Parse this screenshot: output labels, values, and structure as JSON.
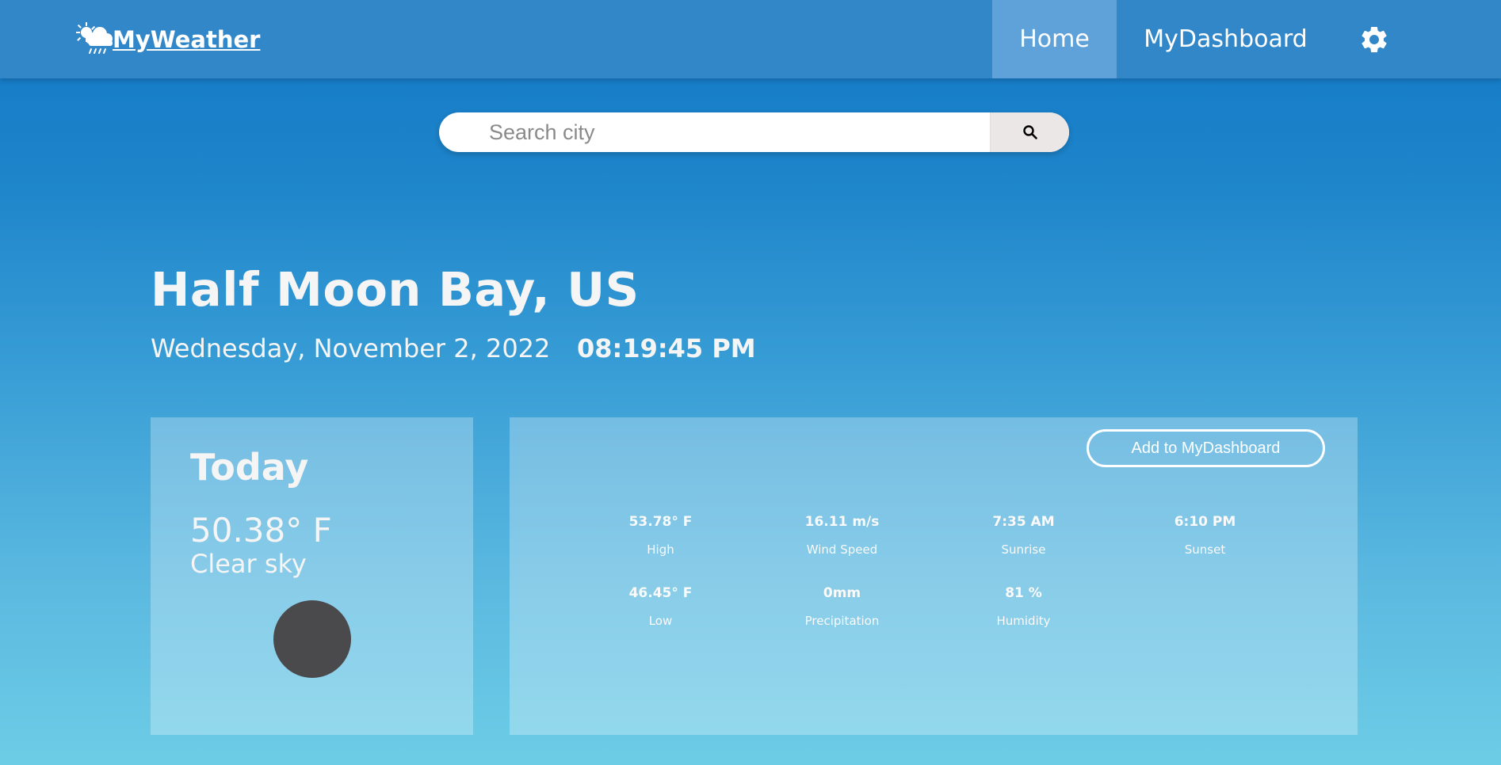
{
  "nav": {
    "brand": "MyWeather",
    "home_label": "Home",
    "dashboard_label": "MyDashboard",
    "settings_icon": "gear-icon",
    "logo_icon": "sun-cloud-rain-icon"
  },
  "search": {
    "placeholder": "Search city",
    "value": "",
    "button_icon": "search-icon"
  },
  "location": {
    "city": "Half Moon Bay, US",
    "date": "Wednesday, November 2, 2022",
    "time": "08:19:45 PM"
  },
  "today": {
    "title": "Today",
    "temperature": "50.38° F",
    "description": "Clear sky",
    "icon": "clear-night-moon-icon"
  },
  "details": {
    "add_button_label": "Add to MyDashboard",
    "stats": [
      {
        "value": "53.78° F",
        "label": "High"
      },
      {
        "value": "16.11 m/s",
        "label": "Wind Speed"
      },
      {
        "value": "7:35 AM",
        "label": "Sunrise"
      },
      {
        "value": "6:10 PM",
        "label": "Sunset"
      },
      {
        "value": "46.45° F",
        "label": "Low"
      },
      {
        "value": "0mm",
        "label": "Precipitation"
      },
      {
        "value": "81 %",
        "label": "Humidity"
      }
    ]
  },
  "colors": {
    "navbar": "#3287c9",
    "nav_active": "#5fa2d9",
    "gradient_top": "#1177c6",
    "gradient_bottom": "#6dcde6",
    "moon": "#4a494c",
    "search_button": "#ece7e7"
  }
}
